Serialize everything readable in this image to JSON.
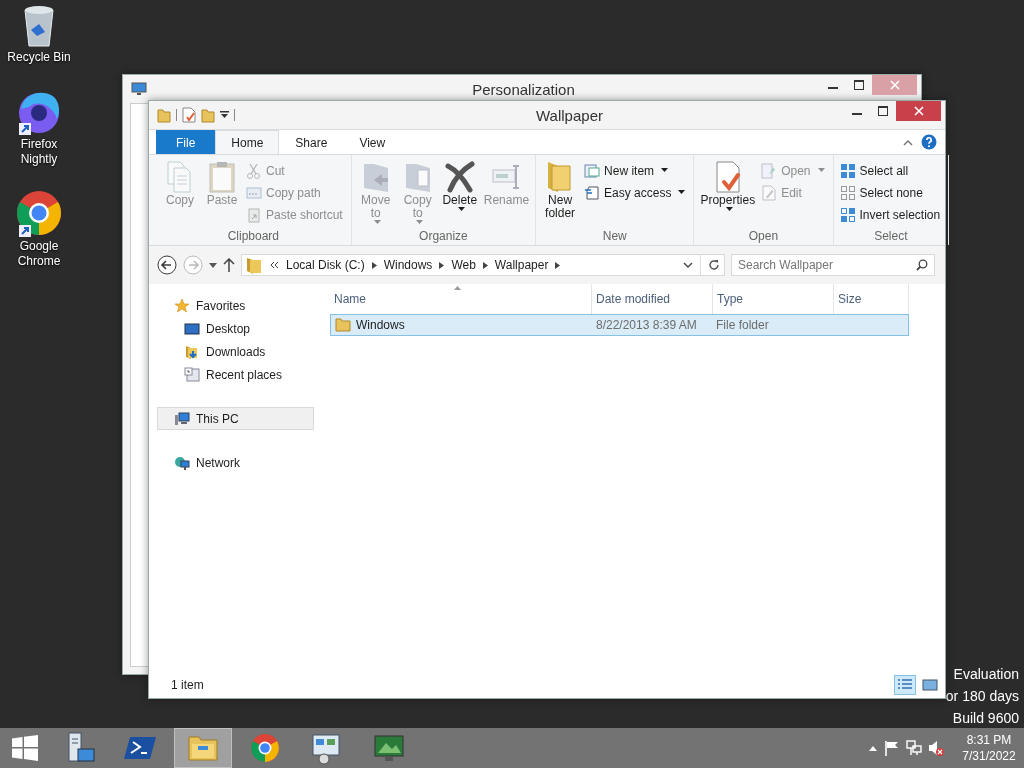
{
  "desktop_icons": [
    {
      "kind": "recycle-bin",
      "label": "Recycle Bin",
      "shortcut": false
    },
    {
      "kind": "firefox",
      "label": "Firefox Nightly",
      "shortcut": true
    },
    {
      "kind": "chrome",
      "label": "Google Chrome",
      "shortcut": true
    }
  ],
  "background_window": {
    "title": "Personalization"
  },
  "window": {
    "title": "Wallpaper",
    "tabs": [
      {
        "label": "File",
        "kind": "file",
        "selected": false
      },
      {
        "label": "Home",
        "kind": "tab",
        "selected": true
      },
      {
        "label": "Share",
        "kind": "tab",
        "selected": false
      },
      {
        "label": "View",
        "kind": "tab",
        "selected": false
      }
    ],
    "ribbon": [
      {
        "label": "Clipboard",
        "large": [
          {
            "kind": "copy",
            "label": "Copy",
            "disabled": true,
            "dropdown": false
          },
          {
            "kind": "paste",
            "label": "Paste",
            "disabled": true,
            "dropdown": false
          }
        ],
        "small": [
          {
            "kind": "cut",
            "label": "Cut",
            "disabled": true,
            "dropdown": false
          },
          {
            "kind": "copy-path",
            "label": "Copy path",
            "disabled": true,
            "dropdown": false
          },
          {
            "kind": "paste-shortcut",
            "label": "Paste shortcut",
            "disabled": true,
            "dropdown": false
          }
        ]
      },
      {
        "label": "Organize",
        "large": [
          {
            "kind": "move",
            "label": "Move to",
            "disabled": true,
            "dropdown": true
          },
          {
            "kind": "copy-to",
            "label": "Copy to",
            "disabled": true,
            "dropdown": true
          },
          {
            "kind": "delete",
            "label": "Delete",
            "disabled": false,
            "dropdown": true
          },
          {
            "kind": "rename",
            "label": "Rename",
            "disabled": true,
            "dropdown": false
          }
        ]
      },
      {
        "label": "New",
        "large": [
          {
            "kind": "new-folder",
            "label": "New folder",
            "disabled": false,
            "dropdown": false
          }
        ],
        "small": [
          {
            "kind": "new-item",
            "label": "New item",
            "disabled": false,
            "dropdown": true
          },
          {
            "kind": "easy-access",
            "label": "Easy access",
            "disabled": false,
            "dropdown": true
          }
        ]
      },
      {
        "label": "Open",
        "large": [
          {
            "kind": "properties",
            "label": "Properties",
            "disabled": false,
            "dropdown": true
          }
        ],
        "small": [
          {
            "kind": "open",
            "label": "Open",
            "disabled": true,
            "dropdown": true
          },
          {
            "kind": "edit",
            "label": "Edit",
            "disabled": true,
            "dropdown": false
          }
        ]
      },
      {
        "label": "Select",
        "small": [
          {
            "kind": "select-all",
            "label": "Select all",
            "disabled": false,
            "dropdown": false
          },
          {
            "kind": "select-none",
            "label": "Select none",
            "disabled": false,
            "dropdown": false
          },
          {
            "kind": "invert",
            "label": "Invert selection",
            "disabled": false,
            "dropdown": false
          }
        ]
      }
    ],
    "back_disabled": false,
    "forward_disabled": true,
    "crumbs": [
      "Local Disk (C:)",
      "Windows",
      "Web",
      "Wallpaper"
    ],
    "search": {
      "placeholder": "Search Wallpaper"
    },
    "nav": [
      {
        "label": "Favorites",
        "kind": "favorites",
        "selected": false,
        "children": [
          {
            "label": "Desktop",
            "kind": "desktop",
            "selected": false
          },
          {
            "label": "Downloads",
            "kind": "downloads",
            "selected": false
          },
          {
            "label": "Recent places",
            "kind": "recent",
            "selected": false
          }
        ]
      },
      {
        "label": "This PC",
        "kind": "pc",
        "selected": true
      },
      {
        "label": "Network",
        "kind": "network",
        "selected": false
      }
    ],
    "columns": [
      "Name",
      "Date modified",
      "Type",
      "Size"
    ],
    "rows": [
      {
        "name": "Windows",
        "date": "8/22/2013 8:39 AM",
        "type": "File folder",
        "selected": true
      }
    ],
    "status": "1 item",
    "views": [
      {
        "kind": "details",
        "selected": true
      },
      {
        "kind": "large-icons",
        "selected": false
      }
    ]
  },
  "evaluation_text": [
    "Evaluation",
    "or 180 days",
    "Build 9600"
  ],
  "taskbar": {
    "apps": [
      {
        "kind": "server-manager",
        "active": false
      },
      {
        "kind": "powershell",
        "active": false
      },
      {
        "kind": "explorer",
        "active": true
      },
      {
        "kind": "chrome",
        "active": false
      },
      {
        "kind": "control",
        "active": false
      },
      {
        "kind": "personalization",
        "active": false
      }
    ],
    "time": "8:31 PM",
    "date": "7/31/2022"
  }
}
